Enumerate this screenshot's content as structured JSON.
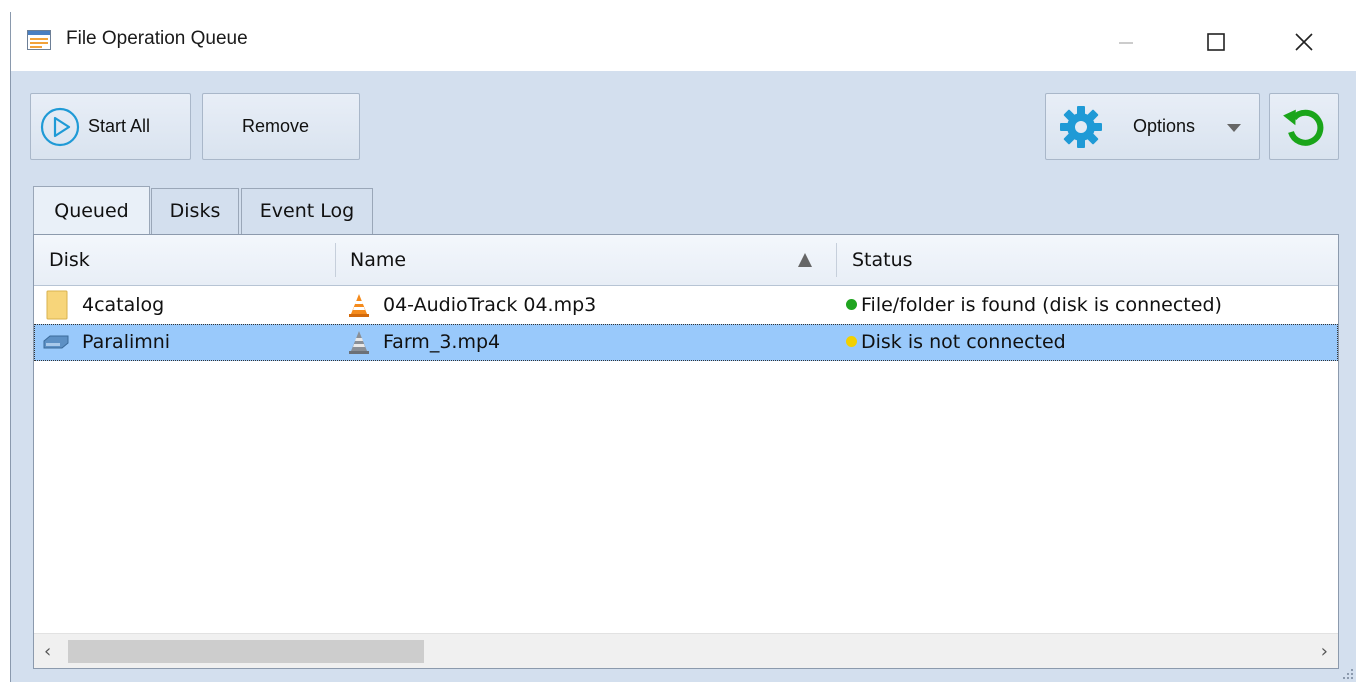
{
  "window": {
    "title": "File Operation Queue",
    "icon": "queue-icon"
  },
  "toolbar": {
    "start_all_label": "Start All",
    "remove_label": "Remove",
    "options_label": "Options",
    "refresh_icon": "refresh-icon"
  },
  "tabs": [
    {
      "label": "Queued",
      "active": true
    },
    {
      "label": "Disks",
      "active": false
    },
    {
      "label": "Event Log",
      "active": false
    }
  ],
  "table": {
    "columns": [
      "Disk",
      "Name",
      "Status"
    ],
    "sort_column": "Name",
    "sort_direction": "ascending",
    "rows": [
      {
        "disk": "4catalog",
        "disk_icon": "folder-icon",
        "name": "04-AudioTrack 04.mp3",
        "file_icon": "vlc-cone-icon",
        "status": "File/folder is found (disk is connected)",
        "status_color": "#1fa41f",
        "selected": false
      },
      {
        "disk": "Paralimni",
        "disk_icon": "disk-drive-icon",
        "name": "Farm_3.mp4",
        "file_icon": "vlc-cone-gray-icon",
        "status": "Disk is not connected",
        "status_color": "#f2d000",
        "selected": true
      }
    ]
  },
  "colors": {
    "window_bg": "#d3dfee",
    "selection": "#99c9fb",
    "accent": "#1f9ad6",
    "refresh": "#1aa51a"
  }
}
